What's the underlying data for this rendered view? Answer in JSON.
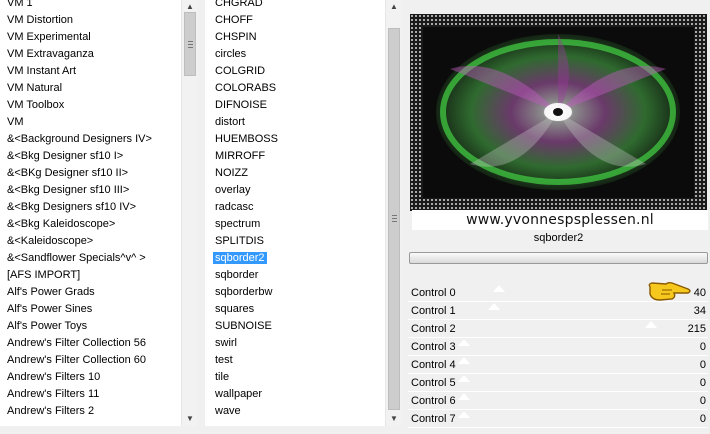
{
  "categories": {
    "items": [
      "VM 1",
      "VM Distortion",
      "VM Experimental",
      "VM Extravaganza",
      "VM Instant Art",
      "VM Natural",
      "VM Toolbox",
      "VM",
      "&<Background Designers IV>",
      "&<Bkg Designer sf10 I>",
      "&<BKg Designer sf10 II>",
      "&<Bkg Designer sf10 III>",
      "&<Bkg Designers sf10 IV>",
      "&<Bkg Kaleidoscope>",
      "&<Kaleidoscope>",
      "&<Sandflower Specials^v^ >",
      "[AFS IMPORT]",
      "Alf's Power Grads",
      "Alf's Power Sines",
      "Alf's Power Toys",
      "Andrew's Filter Collection 56",
      "Andrew's Filter Collection 60",
      "Andrew's Filters 10",
      "Andrew's Filters 11",
      "Andrew's Filters 2"
    ]
  },
  "filters": {
    "selected": "sqborder2",
    "items": [
      "CHGRAD",
      "CHOFF",
      "CHSPIN",
      "circles",
      "COLGRID",
      "COLORABS",
      "DIFNOISE",
      "distort",
      "HUEMBOSS",
      "MIRROFF",
      "NOIZZ",
      "overlay",
      "radcasc",
      "spectrum",
      "SPLITDIS",
      "sqborder2",
      "sqborder",
      "sqborderbw",
      "squares",
      "SUBNOISE",
      "swirl",
      "test",
      "tile",
      "wallpaper",
      "wave"
    ]
  },
  "preview": {
    "watermark": "www.yvonnespsplessen.nl"
  },
  "filter_name": "sqborder2",
  "controls": [
    {
      "label": "Control 0",
      "value": "40",
      "fraction": 0.157
    },
    {
      "label": "Control 1",
      "value": "34",
      "fraction": 0.133
    },
    {
      "label": "Control 2",
      "value": "215",
      "fraction": 0.843
    },
    {
      "label": "Control 3",
      "value": "0",
      "fraction": 0
    },
    {
      "label": "Control 4",
      "value": "0",
      "fraction": 0
    },
    {
      "label": "Control 5",
      "value": "0",
      "fraction": 0
    },
    {
      "label": "Control 6",
      "value": "0",
      "fraction": 0
    },
    {
      "label": "Control 7",
      "value": "0",
      "fraction": 0
    }
  ],
  "icons": {
    "pointer": "pointing-hand-icon",
    "scroll_up": "scroll-up-arrow-icon",
    "scroll_down": "scroll-down-arrow-icon"
  },
  "colors": {
    "selection": "#3399ff",
    "preview_green": "#3fbf3f",
    "preview_magenta": "#c05ac0"
  }
}
